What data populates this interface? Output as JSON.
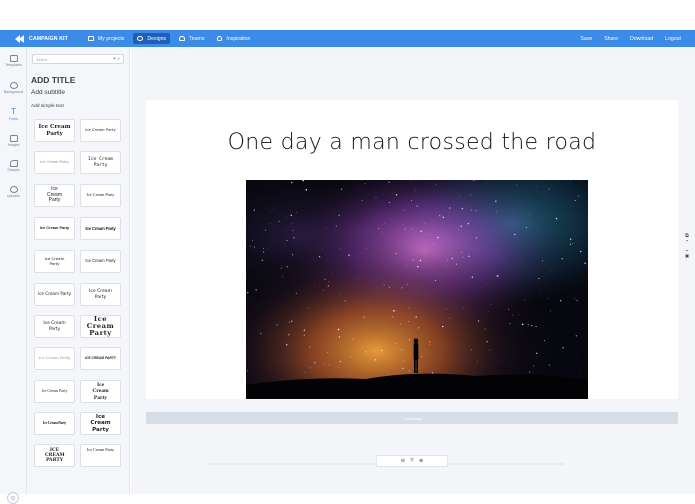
{
  "navbar": {
    "brand": "CAMPAIGN KIT",
    "items": [
      {
        "label": "My projects",
        "icon": "grid-icon"
      },
      {
        "label": "Designs",
        "icon": "palette-icon",
        "active": true
      },
      {
        "label": "Teams",
        "icon": "user-icon"
      },
      {
        "label": "Inspiration",
        "icon": "bulb-icon"
      }
    ],
    "right": [
      "Save",
      "Share",
      "Download",
      "Logout"
    ]
  },
  "rail": [
    {
      "label": "Templates",
      "icon": "templates-icon"
    },
    {
      "label": "Background",
      "icon": "background-icon"
    },
    {
      "label": "Fonts",
      "icon": "text-icon",
      "glyph": "T",
      "active": true
    },
    {
      "label": "Images",
      "icon": "image-icon"
    },
    {
      "label": "Shapes",
      "icon": "shapes-icon"
    },
    {
      "label": "Uploads",
      "icon": "upload-icon"
    }
  ],
  "panel": {
    "search_placeholder": "Select...",
    "add_title": "ADD TITLE",
    "add_subtitle": "Add subtitle",
    "add_simple": "Add simple text",
    "font_tiles": [
      "Ice Cream Party",
      "Ice Cream Party",
      "Ice Cream Party",
      "Ice Cream Party",
      "Ice Cream Party",
      "Ice Cream Party",
      "Ice Cream Party",
      "Ice Cream Party",
      "Ice Cream Party",
      "Ice Cream Party",
      "Ice Cream Party",
      "Ice Cream Party",
      "Ice Cream Party",
      "Ice Cream Party",
      "Ice Cream Party",
      "ICE CREAM PARTY",
      "Ice Cream Party",
      "Ice Cream Party",
      "Ice Cream Party",
      "Ice Cream Party",
      "ICE CREAM PARTY",
      "Ice Cream Party"
    ]
  },
  "canvas": {
    "headline": "One day a man crossed the road",
    "add_page": "+ add page",
    "zoom_controls": [
      "zoom-out-icon",
      "fit-icon",
      "zoom-in-icon"
    ]
  },
  "colors": {
    "accent": "#3d8be8",
    "accent_dark": "#1f5fb8"
  }
}
